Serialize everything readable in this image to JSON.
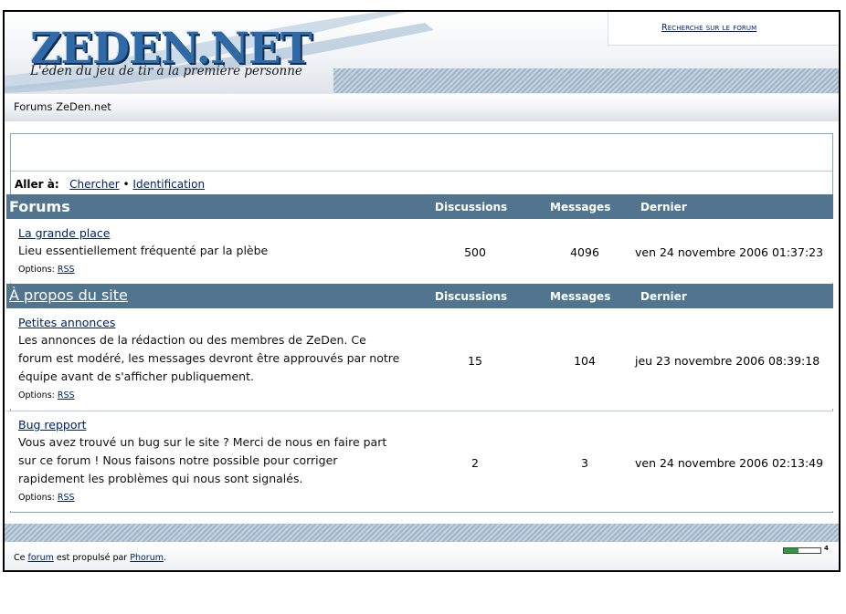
{
  "header": {
    "logo_text": "ZEDEN.NET",
    "tagline": "L'éden du jeu de tir à la première personne",
    "search_link": "Recherche sur le forum"
  },
  "breadcrumb": "Forums ZeDen.net",
  "goto": {
    "label": "Aller à:",
    "links": [
      "Chercher",
      "Identification"
    ],
    "separator": "•"
  },
  "columns": {
    "discussions": "Discussions",
    "messages": "Messages",
    "last": "Dernier"
  },
  "categories": [
    {
      "title": "Forums",
      "forums": [
        {
          "name": "La grande place",
          "description": "Lieu essentiellement fréquenté par la plèbe",
          "options_label": "Options:",
          "rss": "RSS",
          "discussions": "500",
          "messages": "4096",
          "last": "ven 24 novembre 2006 01:37:23"
        }
      ]
    },
    {
      "title": "À propos du site",
      "forums": [
        {
          "name": "Petites annonces",
          "description": "Les annonces de la rédaction ou des membres de ZeDen. Ce forum est modéré, les messages devront être approuvés par notre équipe avant de s'afficher publiquement.",
          "options_label": "Options:",
          "rss": "RSS",
          "discussions": "15",
          "messages": "104",
          "last": "jeu 23 novembre 2006 08:39:18"
        },
        {
          "name": "Bug repport",
          "description": "Vous avez trouvé un bug sur le site ? Merci de nous en faire part sur ce forum ! Nous faisons notre possible pour corriger rapidement les problèmes qui nous sont signalés.",
          "options_label": "Options:",
          "rss": "RSS",
          "discussions": "2",
          "messages": "3",
          "last": "ven 24 novembre 2006 02:13:49"
        }
      ]
    }
  ],
  "footer": {
    "prefix": "Ce ",
    "forum_link": "forum",
    "middle": " est propulsé par ",
    "phorum_link": "Phorum",
    "suffix": ".",
    "stat_value": "4",
    "stat_fill_fraction": 0.4
  },
  "colors": {
    "category_header_bg": "#52758f",
    "link": "#00206e",
    "logo_blue": "#2f6aa6",
    "stat_fill": "#2e9a3c"
  }
}
